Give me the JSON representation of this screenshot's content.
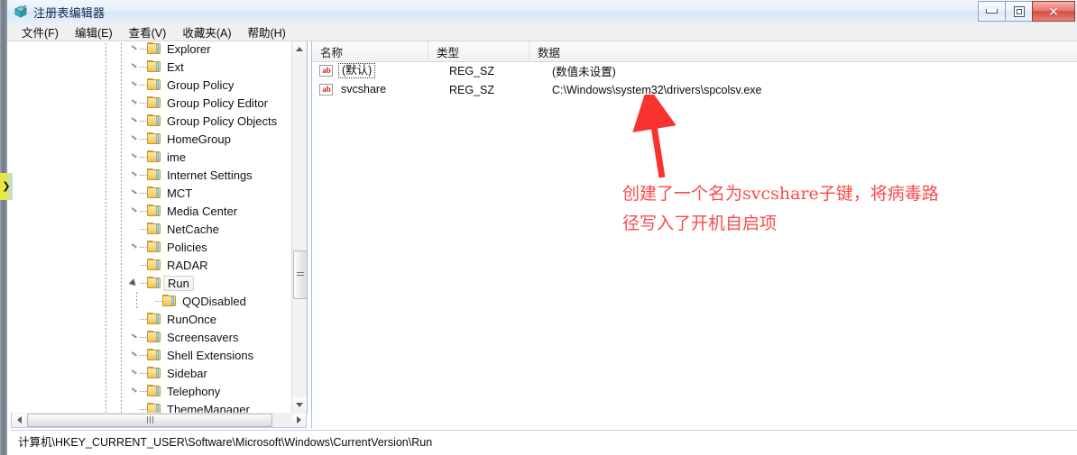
{
  "window": {
    "title": "注册表编辑器",
    "app_icon": "registry-editor-icon",
    "buttons": {
      "minimize": "minimize-icon",
      "maximize": "restore-icon",
      "close": "✕"
    }
  },
  "menubar": {
    "items": [
      {
        "label": "文件(F)",
        "name": "menu-file"
      },
      {
        "label": "编辑(E)",
        "name": "menu-edit"
      },
      {
        "label": "查看(V)",
        "name": "menu-view"
      },
      {
        "label": "收藏夹(A)",
        "name": "menu-favorites"
      },
      {
        "label": "帮助(H)",
        "name": "menu-help"
      }
    ]
  },
  "tree": {
    "items": [
      {
        "label": "Explorer",
        "indent": 2,
        "state": "collapsed",
        "selected": false
      },
      {
        "label": "Ext",
        "indent": 2,
        "state": "collapsed",
        "selected": false
      },
      {
        "label": "Group Policy",
        "indent": 2,
        "state": "collapsed",
        "selected": false
      },
      {
        "label": "Group Policy Editor",
        "indent": 2,
        "state": "collapsed",
        "selected": false
      },
      {
        "label": "Group Policy Objects",
        "indent": 2,
        "state": "collapsed",
        "selected": false
      },
      {
        "label": "HomeGroup",
        "indent": 2,
        "state": "collapsed",
        "selected": false
      },
      {
        "label": "ime",
        "indent": 2,
        "state": "collapsed",
        "selected": false
      },
      {
        "label": "Internet Settings",
        "indent": 2,
        "state": "collapsed",
        "selected": false
      },
      {
        "label": "MCT",
        "indent": 2,
        "state": "collapsed",
        "selected": false
      },
      {
        "label": "Media Center",
        "indent": 2,
        "state": "collapsed",
        "selected": false
      },
      {
        "label": "NetCache",
        "indent": 2,
        "state": "leaf",
        "selected": false
      },
      {
        "label": "Policies",
        "indent": 2,
        "state": "collapsed",
        "selected": false
      },
      {
        "label": "RADAR",
        "indent": 2,
        "state": "leaf",
        "selected": false
      },
      {
        "label": "Run",
        "indent": 2,
        "state": "expanded",
        "selected": true
      },
      {
        "label": "QQDisabled",
        "indent": 3,
        "state": "leaf",
        "selected": false
      },
      {
        "label": "RunOnce",
        "indent": 2,
        "state": "leaf",
        "selected": false
      },
      {
        "label": "Screensavers",
        "indent": 2,
        "state": "collapsed",
        "selected": false
      },
      {
        "label": "Shell Extensions",
        "indent": 2,
        "state": "collapsed",
        "selected": false
      },
      {
        "label": "Sidebar",
        "indent": 2,
        "state": "collapsed",
        "selected": false
      },
      {
        "label": "Telephony",
        "indent": 2,
        "state": "collapsed",
        "selected": false
      },
      {
        "label": "ThemeManager",
        "indent": 2,
        "state": "leaf",
        "selected": false
      }
    ]
  },
  "list": {
    "columns": [
      "名称",
      "类型",
      "数据"
    ],
    "rows": [
      {
        "icon": "string-value-icon",
        "name": "(默认)",
        "type": "REG_SZ",
        "data": "(数值未设置)",
        "focused": true
      },
      {
        "icon": "string-value-icon",
        "name": "svcshare",
        "type": "REG_SZ",
        "data": "C:\\Windows\\system32\\drivers\\spcolsv.exe",
        "focused": false
      }
    ]
  },
  "statusbar": {
    "path": "计算机\\HKEY_CURRENT_USER\\Software\\Microsoft\\Windows\\CurrentVersion\\Run"
  },
  "annotation": {
    "text": "创建了一个名为svcshare子键，将病毒路\n径写入了开机自启项",
    "color": "#fb4a4a",
    "arrow": "red-up-arrow"
  },
  "edge_tab": {
    "glyph": "❯",
    "name": "sidebar-expand-tab"
  }
}
